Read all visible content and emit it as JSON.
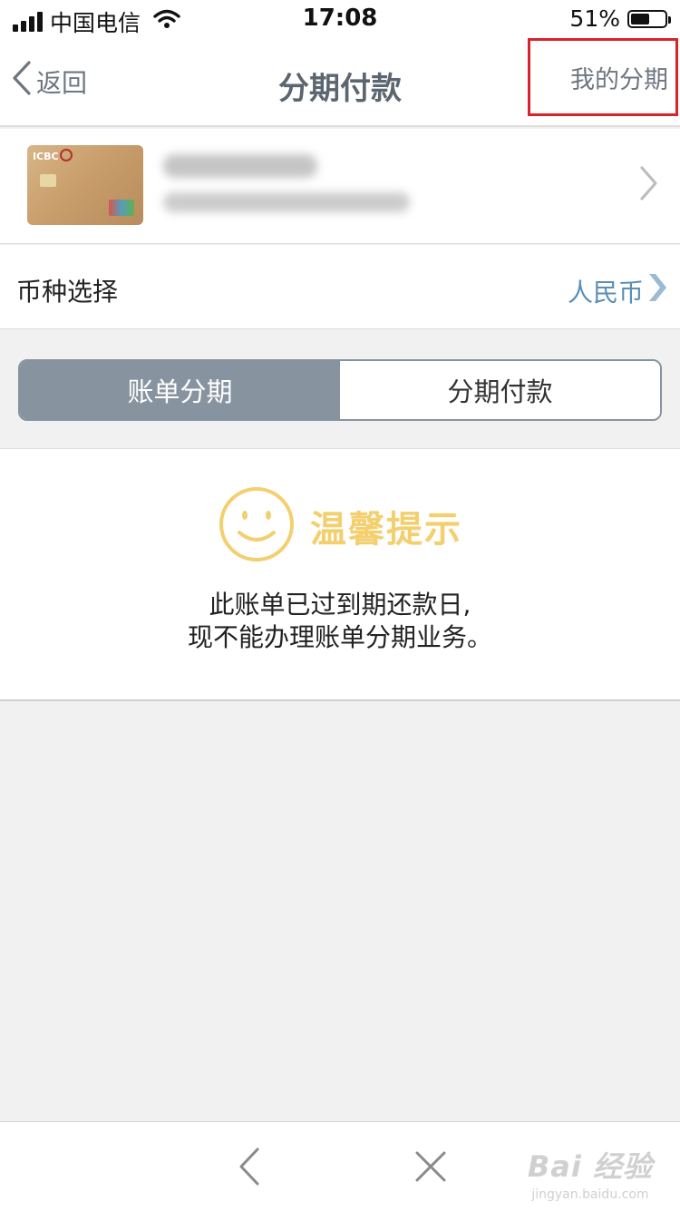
{
  "status_bar": {
    "carrier": "中国电信",
    "time": "17:08",
    "battery": "51%"
  },
  "nav": {
    "back_label": "返回",
    "title": "分期付款",
    "right_action": "我的分期"
  },
  "card": {
    "brand": "ICBC"
  },
  "currency": {
    "label": "币种选择",
    "value": "人民币"
  },
  "tabs": [
    {
      "label": "账单分期",
      "active": true
    },
    {
      "label": "分期付款",
      "active": false
    }
  ],
  "tip": {
    "title": "温馨提示",
    "line1": "此账单已过到期还款日,",
    "line2": "现不能办理账单分期业务。"
  },
  "watermark": {
    "main": "Bai  经验",
    "sub": "jingyan.baidu.com"
  },
  "colors": {
    "accent": "#8794a0",
    "tip_yellow": "#f3cf6e",
    "currency_blue": "#5b8fb8",
    "highlight_red": "#d8232a"
  }
}
